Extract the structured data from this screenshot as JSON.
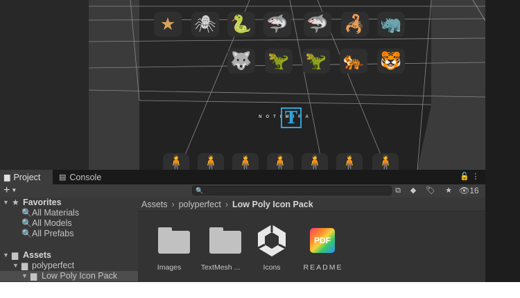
{
  "tabs": {
    "project": "Project",
    "console": "Console"
  },
  "toolbar": {
    "add_label": "+",
    "search_value": "",
    "search_placeholder": "",
    "hidden_count": "16"
  },
  "tree": {
    "favorites": "Favorites",
    "all_materials": "All Materials",
    "all_models": "All Models",
    "all_prefabs": "All Prefabs",
    "assets": "Assets",
    "polyperfect": "polyperfect",
    "low_poly_icon_pack": "Low Poly Icon Pack"
  },
  "breadcrumb": [
    "Assets",
    "polyperfect",
    "Low Poly Icon Pack"
  ],
  "files": [
    "Images",
    "TextMesh ...",
    "Icons",
    "README"
  ],
  "pdf_label": "PDF",
  "scene": {
    "logo_letter": "T",
    "logo_text": "NOTIMIRA"
  },
  "colors": {
    "accent": "#2aa7e0",
    "figure": "#d68b3c",
    "panel": "#383838"
  }
}
